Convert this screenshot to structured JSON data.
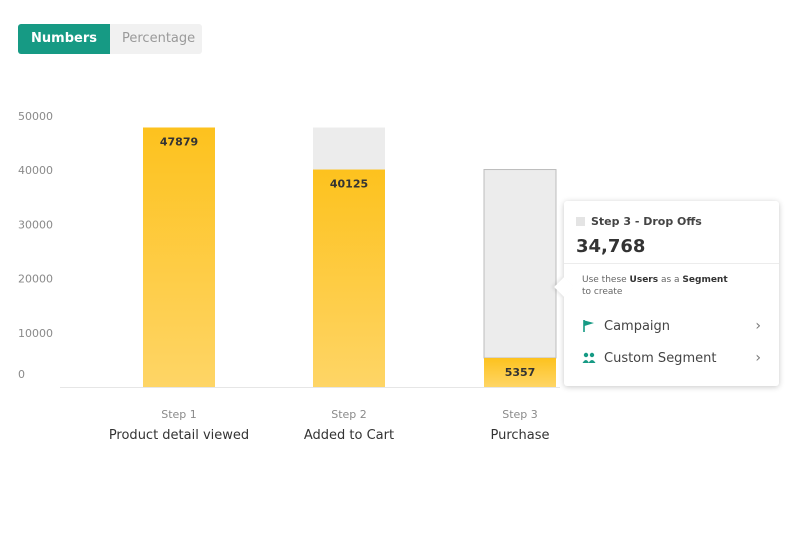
{
  "toggle": {
    "numbers_label": "Numbers",
    "percentage_label": "Percentage"
  },
  "colors": {
    "accent": "#169a84",
    "bar": "#fdc52a",
    "dropoff": "#ececec"
  },
  "chart_data": {
    "type": "bar",
    "ylim": [
      0,
      50000
    ],
    "yticks": [
      "0",
      "10000",
      "20000",
      "30000",
      "40000",
      "50000"
    ],
    "categories": [
      {
        "step": "Step 1",
        "name": "Product detail viewed"
      },
      {
        "step": "Step 2",
        "name": "Added to Cart"
      },
      {
        "step": "Step 3",
        "name": "Purchase"
      }
    ],
    "series": [
      {
        "values": [
          47879,
          40125,
          5357
        ]
      },
      {
        "values": [
          0,
          7754,
          34768
        ]
      }
    ],
    "value_labels": [
      "47879",
      "40125",
      "5357"
    ]
  },
  "popover": {
    "title": "Step 3 - Drop Offs",
    "value": "34,768",
    "hint_prefix": "Use these ",
    "hint_users": "Users",
    "hint_middle": " as a ",
    "hint_segment": "Segment",
    "hint_suffix": "to create",
    "campaign_label": "Campaign",
    "custom_segment_label": "Custom Segment",
    "campaign_icon": "flag-icon",
    "segment_icon": "users-icon"
  }
}
